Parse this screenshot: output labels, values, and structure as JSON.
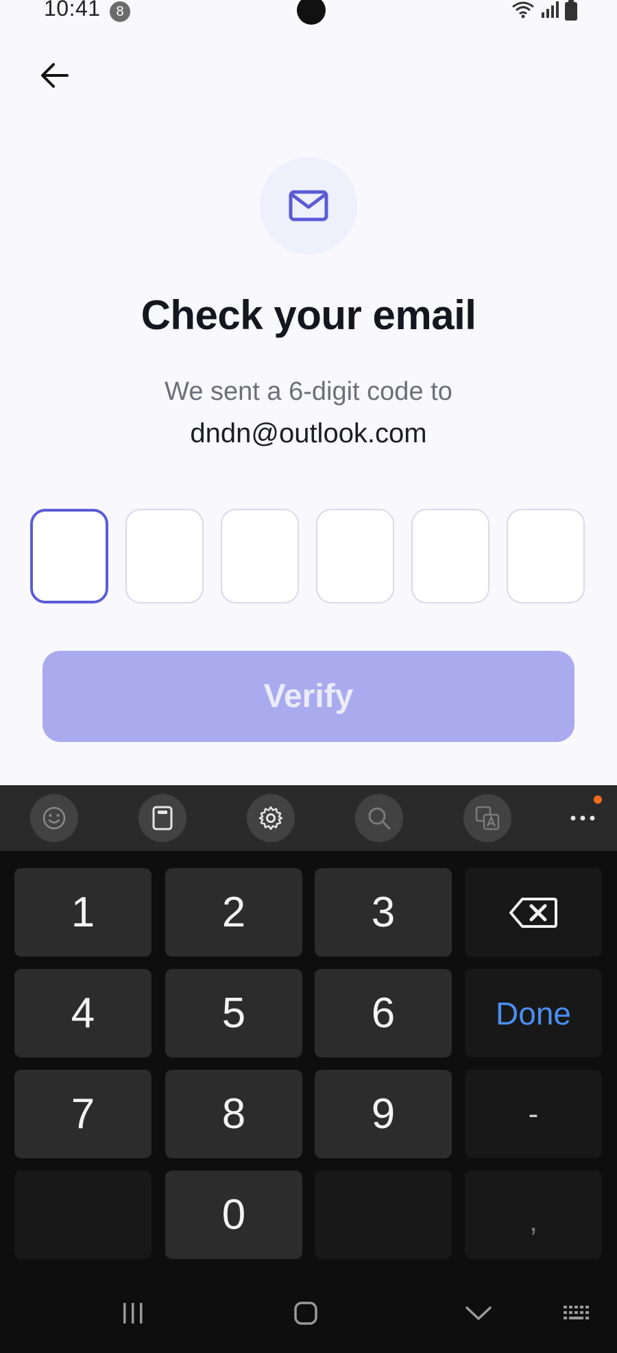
{
  "status_bar": {
    "time": "10:41",
    "notification_count": "8"
  },
  "screen": {
    "title": "Check your email",
    "subtitle": "We sent a 6-digit code to",
    "email": "dndn@outlook.com",
    "code_length": 6,
    "active_box_index": 0,
    "verify_label": "Verify",
    "colors": {
      "accent": "#5b5bd6",
      "button_disabled": "#a9abee",
      "background": "#f8f8fd"
    }
  },
  "keyboard": {
    "toolbar": [
      "emoji-icon",
      "clipboard-icon",
      "settings-icon",
      "search-icon",
      "translate-icon",
      "more-icon"
    ],
    "keys": {
      "k1": "1",
      "k2": "2",
      "k3": "3",
      "k4": "4",
      "k5": "5",
      "k6": "6",
      "k7": "7",
      "k8": "8",
      "k9": "9",
      "k0": "0",
      "done": "Done",
      "minus": "-",
      "comma": ","
    },
    "done_color": "#4b8ef0"
  },
  "nav_bar": [
    "recents-icon",
    "home-icon",
    "hide-keyboard-icon",
    "keyboard-switch-icon"
  ]
}
